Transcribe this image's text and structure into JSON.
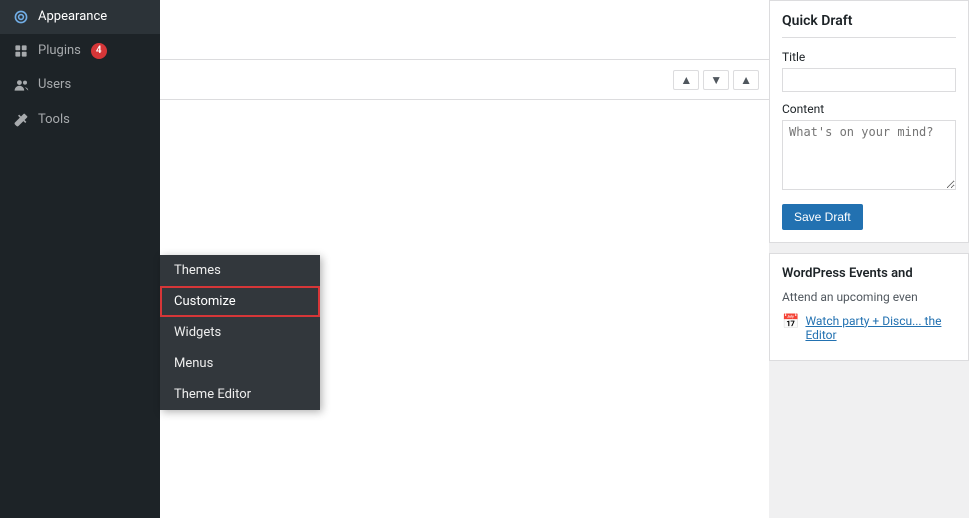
{
  "sidebar": {
    "items": [
      {
        "id": "appearance",
        "label": "Appearance",
        "icon": "🎨",
        "active": true,
        "badge": null
      },
      {
        "id": "plugins",
        "label": "Plugins",
        "icon": "🔌",
        "active": false,
        "badge": "4"
      },
      {
        "id": "users",
        "label": "Users",
        "icon": "👤",
        "active": false,
        "badge": null
      },
      {
        "id": "tools",
        "label": "Tools",
        "icon": "🔧",
        "active": false,
        "badge": null
      }
    ]
  },
  "flyout": {
    "items": [
      {
        "id": "themes",
        "label": "Themes",
        "highlighted": false
      },
      {
        "id": "customize",
        "label": "Customize",
        "highlighted": true
      },
      {
        "id": "widgets",
        "label": "Widgets",
        "highlighted": false
      },
      {
        "id": "menus",
        "label": "Menus",
        "highlighted": false
      },
      {
        "id": "theme-editor",
        "label": "Theme Editor",
        "highlighted": false
      }
    ]
  },
  "toolbar": {
    "up_label": "▲",
    "down_label": "▼",
    "expand_label": "▲"
  },
  "quick_draft": {
    "title": "Quick Draft",
    "title_label": "Title",
    "title_placeholder": "",
    "content_label": "Content",
    "content_placeholder": "What's on your mind?",
    "save_label": "Save Draft"
  },
  "events": {
    "title": "WordPress Events and",
    "description": "Attend an upcoming even",
    "event_link": "Watch party + Discu... the Editor",
    "event_icon": "📅"
  }
}
